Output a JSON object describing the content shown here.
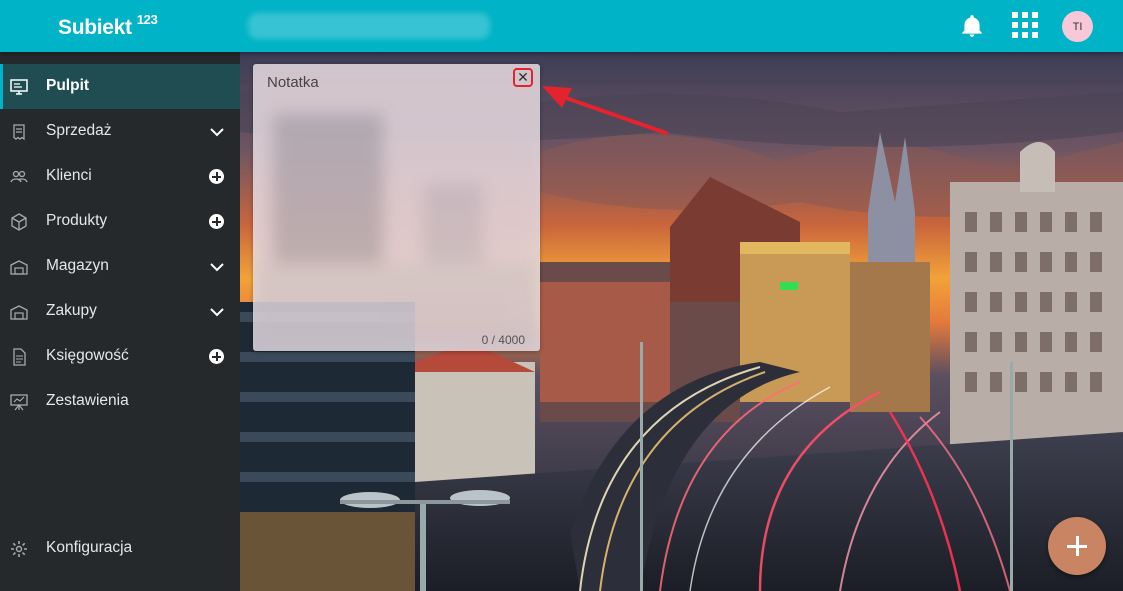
{
  "app": {
    "logo_text": "Subiekt",
    "logo_sup": "123",
    "avatar_initials": "TI",
    "accent_color": "#00b3c7"
  },
  "header": {
    "icons": [
      "bell-icon",
      "apps-grid-icon"
    ]
  },
  "sidebar": {
    "items": [
      {
        "label": "Pulpit",
        "icon": "desktop-icon",
        "active": true
      },
      {
        "label": "Sprzedaż",
        "icon": "receipt-icon",
        "action": "chevron-down"
      },
      {
        "label": "Klienci",
        "icon": "users-icon",
        "action": "add"
      },
      {
        "label": "Produkty",
        "icon": "box-icon",
        "action": "add"
      },
      {
        "label": "Magazyn",
        "icon": "warehouse-icon",
        "action": "chevron-down"
      },
      {
        "label": "Zakupy",
        "icon": "truck-icon",
        "action": "chevron-down"
      },
      {
        "label": "Księgowość",
        "icon": "document-icon",
        "action": "add"
      },
      {
        "label": "Zestawienia",
        "icon": "presentation-icon"
      }
    ],
    "footer": {
      "label": "Konfiguracja",
      "icon": "gear-icon"
    }
  },
  "note": {
    "title": "Notatka",
    "close": "✕",
    "counter": "0 / 4000"
  },
  "fab": {
    "icon": "plus-icon"
  }
}
